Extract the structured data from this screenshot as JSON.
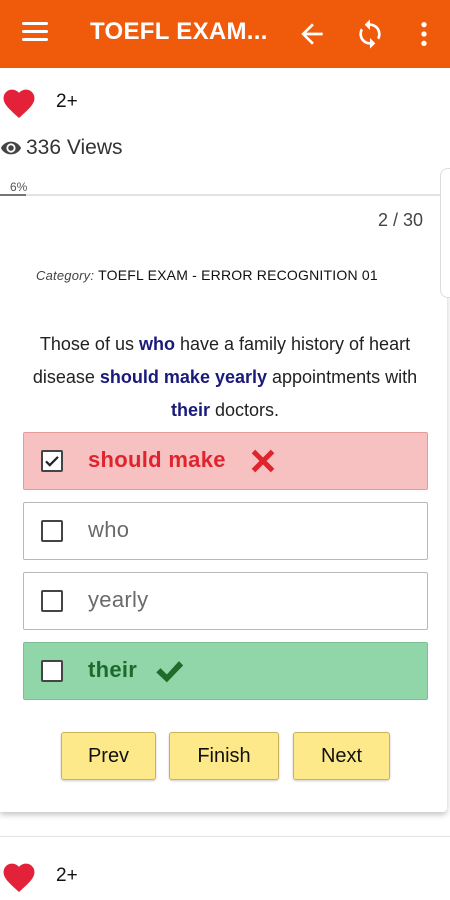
{
  "appbar": {
    "title": "TOEFL EXAM...",
    "background_color": "#f05a0b",
    "icons": [
      "menu-icon",
      "back-arrow-icon",
      "sync-icon",
      "more-vert-icon"
    ]
  },
  "likes_top": {
    "count": "2+"
  },
  "views": {
    "label": "336 Views"
  },
  "progress": {
    "percent_label": "6%",
    "value": 0.06
  },
  "quiz": {
    "counter": "2 / 30",
    "category_label": "Category:",
    "category_name": "TOEFL EXAM - ERROR RECOGNITION 01",
    "question": {
      "part1": "Those of us ",
      "hl1": "who",
      "part2": " have a family history of heart disease ",
      "hl2": "should make yearly",
      "part3": " appointments with ",
      "hl3": "their",
      "part4": " doctors."
    },
    "options": [
      {
        "text": "should make",
        "state": "selected-wrong",
        "checked": true
      },
      {
        "text": "who",
        "state": "unselected",
        "checked": false
      },
      {
        "text": "yearly",
        "state": "unselected",
        "checked": false
      },
      {
        "text": "their",
        "state": "correct",
        "checked": false
      }
    ],
    "buttons": {
      "prev": "Prev",
      "finish": "Finish",
      "next": "Next"
    }
  },
  "likes_bottom": {
    "count": "2+"
  },
  "colors": {
    "wrong_bg": "#f7c1c1",
    "wrong_text": "#e0242e",
    "correct_bg": "#91d6a9",
    "correct_text": "#1d6b2c",
    "highlight_text": "#1a1a7a",
    "button_bg": "#fde98a"
  }
}
